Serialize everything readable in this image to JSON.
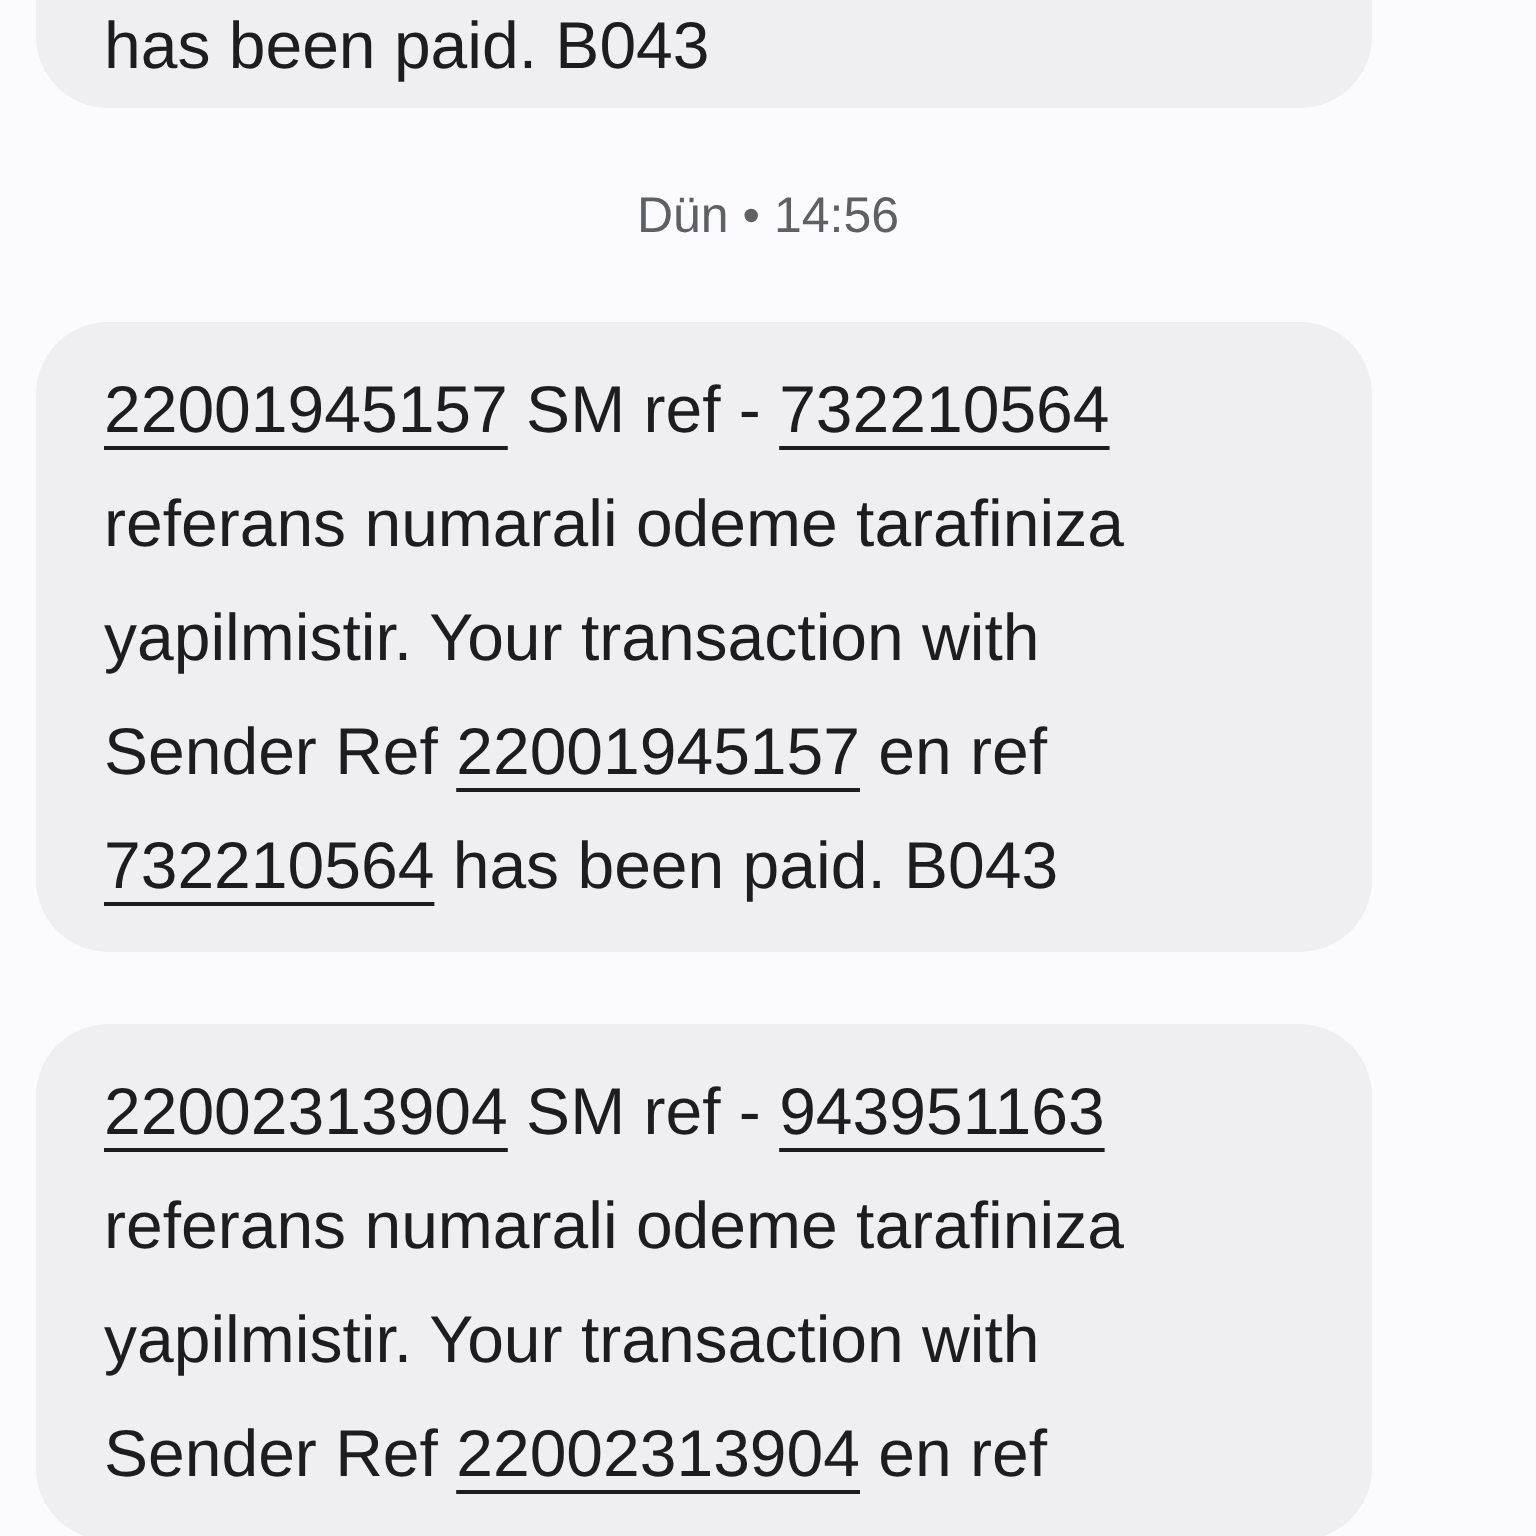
{
  "messages_before": [
    {
      "lines": [
        [
          {
            "text": "has been paid.  B043",
            "link": false
          }
        ]
      ]
    }
  ],
  "timestamp": "Dün • 14:56",
  "messages": [
    {
      "lines": [
        [
          {
            "text": "22001945157",
            "link": true
          },
          {
            "text": " SM ref - ",
            "link": false
          },
          {
            "text": "732210564",
            "link": true
          }
        ],
        [
          {
            "text": "referans numarali odeme tarafiniza",
            "link": false
          }
        ],
        [
          {
            "text": "yapilmistir. Your transaction with",
            "link": false
          }
        ],
        [
          {
            "text": "Sender Ref ",
            "link": false
          },
          {
            "text": "22001945157",
            "link": true
          },
          {
            "text": " en ref",
            "link": false
          }
        ],
        [
          {
            "text": "732210564",
            "link": true
          },
          {
            "text": " has been paid.  B043",
            "link": false
          }
        ]
      ]
    },
    {
      "lines": [
        [
          {
            "text": "22002313904",
            "link": true
          },
          {
            "text": " SM ref - ",
            "link": false
          },
          {
            "text": "943951163",
            "link": true
          }
        ],
        [
          {
            "text": "referans numarali odeme tarafiniza",
            "link": false
          }
        ],
        [
          {
            "text": "yapilmistir. Your transaction with",
            "link": false
          }
        ],
        [
          {
            "text": "Sender Ref ",
            "link": false
          },
          {
            "text": "22002313904",
            "link": true
          },
          {
            "text": " en ref",
            "link": false
          }
        ]
      ]
    }
  ]
}
